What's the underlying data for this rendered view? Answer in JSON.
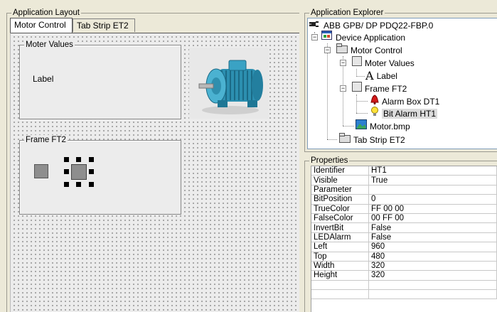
{
  "app_layout": {
    "title": "Application Layout",
    "tabs": [
      {
        "label": "Motor Control",
        "active": true
      },
      {
        "label": "Tab Strip ET2",
        "active": false
      }
    ],
    "motor_values_frame": {
      "title": "Moter Values",
      "label": "Label"
    },
    "frame_ft2": {
      "title": "Frame FT2"
    }
  },
  "app_explorer": {
    "title": "Application Explorer",
    "tree": [
      {
        "label": "ABB GPB/ DP PDQ22-FBP.0",
        "icon": "plug-icon"
      },
      {
        "label": "Device Application",
        "icon": "application-icon"
      },
      {
        "label": "Motor Control",
        "icon": "tab-icon"
      },
      {
        "label": "Moter Values",
        "icon": "frame-icon"
      },
      {
        "label": "Label",
        "icon": "text-label-icon"
      },
      {
        "label": "Frame FT2",
        "icon": "frame-icon"
      },
      {
        "label": "Alarm Box DT1",
        "icon": "alarm-bell-icon"
      },
      {
        "label": "Bit Alarm HT1",
        "icon": "light-bulb-icon",
        "selected": true
      },
      {
        "label": "Motor.bmp",
        "icon": "bitmap-icon"
      },
      {
        "label": "Tab Strip ET2",
        "icon": "tab-icon"
      }
    ]
  },
  "properties": {
    "title": "Properties",
    "rows": [
      {
        "key": "Identifier",
        "value": "HT1"
      },
      {
        "key": "Visible",
        "value": "True"
      },
      {
        "key": "Parameter",
        "value": ""
      },
      {
        "key": "BitPosition",
        "value": "0"
      },
      {
        "key": "TrueColor",
        "value": "FF 00 00"
      },
      {
        "key": "FalseColor",
        "value": "00 FF 00"
      },
      {
        "key": "InvertBit",
        "value": "False"
      },
      {
        "key": "LEDAlarm",
        "value": "False"
      },
      {
        "key": "Left",
        "value": "960"
      },
      {
        "key": "Top",
        "value": "480"
      },
      {
        "key": "Width",
        "value": "320"
      },
      {
        "key": "Height",
        "value": "320"
      },
      {
        "key": "",
        "value": ""
      },
      {
        "key": "",
        "value": ""
      }
    ]
  }
}
